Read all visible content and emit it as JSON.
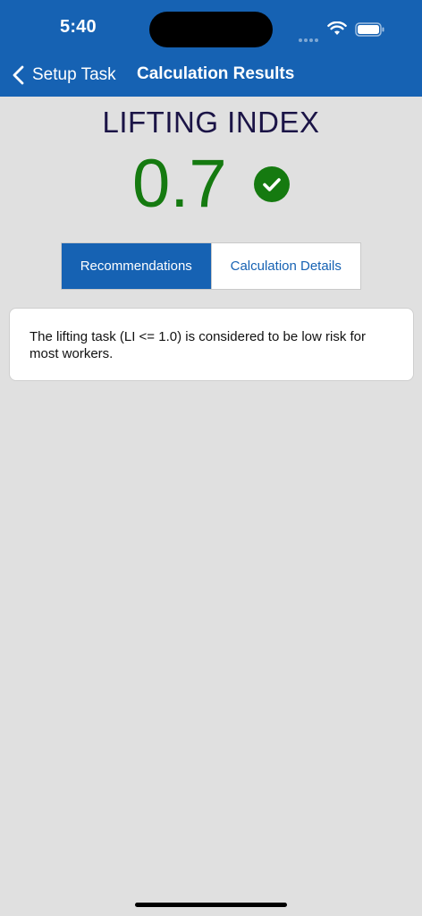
{
  "status_bar": {
    "time": "5:40",
    "icons": [
      "signal-dots-icon",
      "wifi-icon",
      "battery-icon"
    ]
  },
  "nav": {
    "back_label": "Setup Task",
    "back_icon": "chevron-left-icon",
    "title": "Calculation Results"
  },
  "result": {
    "title": "LIFTING INDEX",
    "value": "0.7",
    "status_icon": "checkmark-circle-icon"
  },
  "tabs": [
    {
      "label": "Recommendations",
      "active": true
    },
    {
      "label": "Calculation Details",
      "active": false
    }
  ],
  "recommendation": {
    "text": "The lifting task (LI <= 1.0) is considered to be low risk for most workers."
  },
  "colors": {
    "brand_blue": "#1662b3",
    "value_green": "#157a10",
    "title_navy": "#1b1446",
    "background": "#e0e0e0"
  }
}
